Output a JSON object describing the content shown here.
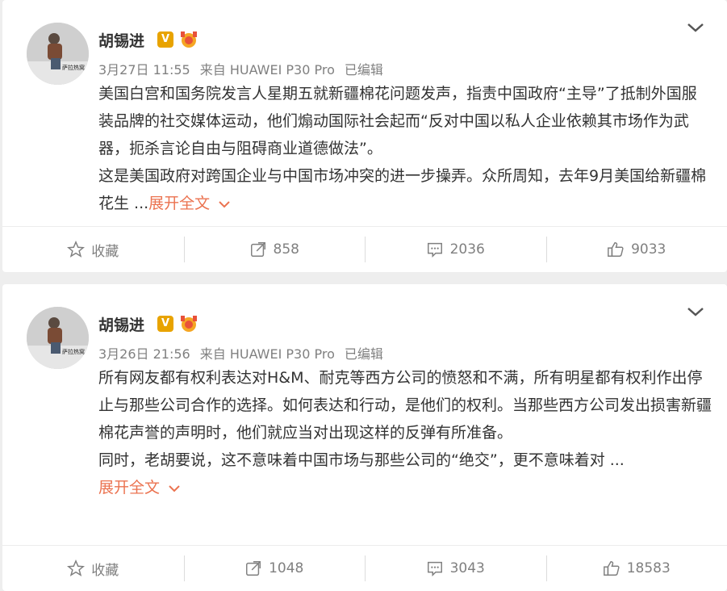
{
  "colors": {
    "accent": "#eb7350",
    "muted": "#808080",
    "badge": "#e8a300"
  },
  "posts": [
    {
      "author": "胡锡进",
      "verified_badge": "V",
      "date": "3月27日 11:55",
      "source": "来自 HUAWEI P30 Pro",
      "edited": "已编辑",
      "paragraphs": [
        "美国白宫和国务院发言人星期五就新疆棉花问题发声，指责中国政府“主导”了抵制外国服装品牌的社交媒体运动，他们煽动国际社会起而“反对中国以私人企业依赖其市场作为武器，扼杀言论自由与阻碍商业道德做法”。",
        "这是美国政府对跨国企业与中国市场冲突的进一步操弄。众所周知，去年9月美国给新疆棉花生 ..."
      ],
      "expand_label": "展开全文",
      "actions": {
        "favorite": "收藏",
        "repost": "858",
        "comment": "2036",
        "like": "9033"
      }
    },
    {
      "author": "胡锡进",
      "verified_badge": "V",
      "date": "3月26日 21:56",
      "source": "来自 HUAWEI P30 Pro",
      "edited": "已编辑",
      "paragraphs": [
        "所有网友都有权利表达对H&M、耐克等西方公司的愤怒和不满，所有明星都有权利作出停止与那些公司合作的选择。如何表达和行动，是他们的权利。当那些西方公司发出损害新疆棉花声誉的声明时，他们就应当对出现这样的反弹有所准备。",
        "同时，老胡要说，这不意味着中国市场与那些公司的“绝交”，更不意味着对 ..."
      ],
      "expand_label": "展开全文",
      "actions": {
        "favorite": "收藏",
        "repost": "1048",
        "comment": "3043",
        "like": "18583"
      }
    }
  ]
}
